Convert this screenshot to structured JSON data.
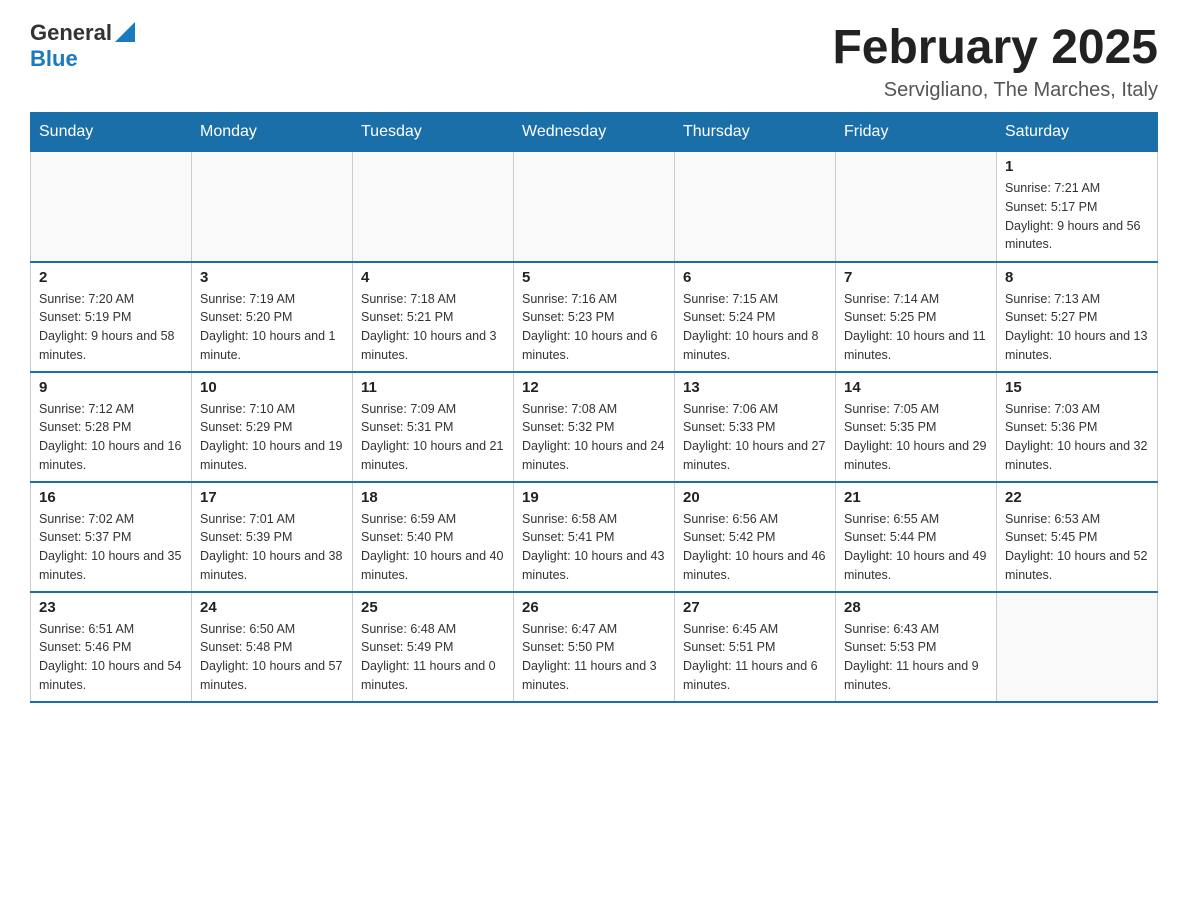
{
  "header": {
    "logo": {
      "text_general": "General",
      "text_blue": "Blue"
    },
    "title": "February 2025",
    "subtitle": "Servigliano, The Marches, Italy"
  },
  "days_of_week": [
    "Sunday",
    "Monday",
    "Tuesday",
    "Wednesday",
    "Thursday",
    "Friday",
    "Saturday"
  ],
  "weeks": [
    {
      "days": [
        {
          "number": "",
          "info": ""
        },
        {
          "number": "",
          "info": ""
        },
        {
          "number": "",
          "info": ""
        },
        {
          "number": "",
          "info": ""
        },
        {
          "number": "",
          "info": ""
        },
        {
          "number": "",
          "info": ""
        },
        {
          "number": "1",
          "info": "Sunrise: 7:21 AM\nSunset: 5:17 PM\nDaylight: 9 hours and 56 minutes."
        }
      ]
    },
    {
      "days": [
        {
          "number": "2",
          "info": "Sunrise: 7:20 AM\nSunset: 5:19 PM\nDaylight: 9 hours and 58 minutes."
        },
        {
          "number": "3",
          "info": "Sunrise: 7:19 AM\nSunset: 5:20 PM\nDaylight: 10 hours and 1 minute."
        },
        {
          "number": "4",
          "info": "Sunrise: 7:18 AM\nSunset: 5:21 PM\nDaylight: 10 hours and 3 minutes."
        },
        {
          "number": "5",
          "info": "Sunrise: 7:16 AM\nSunset: 5:23 PM\nDaylight: 10 hours and 6 minutes."
        },
        {
          "number": "6",
          "info": "Sunrise: 7:15 AM\nSunset: 5:24 PM\nDaylight: 10 hours and 8 minutes."
        },
        {
          "number": "7",
          "info": "Sunrise: 7:14 AM\nSunset: 5:25 PM\nDaylight: 10 hours and 11 minutes."
        },
        {
          "number": "8",
          "info": "Sunrise: 7:13 AM\nSunset: 5:27 PM\nDaylight: 10 hours and 13 minutes."
        }
      ]
    },
    {
      "days": [
        {
          "number": "9",
          "info": "Sunrise: 7:12 AM\nSunset: 5:28 PM\nDaylight: 10 hours and 16 minutes."
        },
        {
          "number": "10",
          "info": "Sunrise: 7:10 AM\nSunset: 5:29 PM\nDaylight: 10 hours and 19 minutes."
        },
        {
          "number": "11",
          "info": "Sunrise: 7:09 AM\nSunset: 5:31 PM\nDaylight: 10 hours and 21 minutes."
        },
        {
          "number": "12",
          "info": "Sunrise: 7:08 AM\nSunset: 5:32 PM\nDaylight: 10 hours and 24 minutes."
        },
        {
          "number": "13",
          "info": "Sunrise: 7:06 AM\nSunset: 5:33 PM\nDaylight: 10 hours and 27 minutes."
        },
        {
          "number": "14",
          "info": "Sunrise: 7:05 AM\nSunset: 5:35 PM\nDaylight: 10 hours and 29 minutes."
        },
        {
          "number": "15",
          "info": "Sunrise: 7:03 AM\nSunset: 5:36 PM\nDaylight: 10 hours and 32 minutes."
        }
      ]
    },
    {
      "days": [
        {
          "number": "16",
          "info": "Sunrise: 7:02 AM\nSunset: 5:37 PM\nDaylight: 10 hours and 35 minutes."
        },
        {
          "number": "17",
          "info": "Sunrise: 7:01 AM\nSunset: 5:39 PM\nDaylight: 10 hours and 38 minutes."
        },
        {
          "number": "18",
          "info": "Sunrise: 6:59 AM\nSunset: 5:40 PM\nDaylight: 10 hours and 40 minutes."
        },
        {
          "number": "19",
          "info": "Sunrise: 6:58 AM\nSunset: 5:41 PM\nDaylight: 10 hours and 43 minutes."
        },
        {
          "number": "20",
          "info": "Sunrise: 6:56 AM\nSunset: 5:42 PM\nDaylight: 10 hours and 46 minutes."
        },
        {
          "number": "21",
          "info": "Sunrise: 6:55 AM\nSunset: 5:44 PM\nDaylight: 10 hours and 49 minutes."
        },
        {
          "number": "22",
          "info": "Sunrise: 6:53 AM\nSunset: 5:45 PM\nDaylight: 10 hours and 52 minutes."
        }
      ]
    },
    {
      "days": [
        {
          "number": "23",
          "info": "Sunrise: 6:51 AM\nSunset: 5:46 PM\nDaylight: 10 hours and 54 minutes."
        },
        {
          "number": "24",
          "info": "Sunrise: 6:50 AM\nSunset: 5:48 PM\nDaylight: 10 hours and 57 minutes."
        },
        {
          "number": "25",
          "info": "Sunrise: 6:48 AM\nSunset: 5:49 PM\nDaylight: 11 hours and 0 minutes."
        },
        {
          "number": "26",
          "info": "Sunrise: 6:47 AM\nSunset: 5:50 PM\nDaylight: 11 hours and 3 minutes."
        },
        {
          "number": "27",
          "info": "Sunrise: 6:45 AM\nSunset: 5:51 PM\nDaylight: 11 hours and 6 minutes."
        },
        {
          "number": "28",
          "info": "Sunrise: 6:43 AM\nSunset: 5:53 PM\nDaylight: 11 hours and 9 minutes."
        },
        {
          "number": "",
          "info": ""
        }
      ]
    }
  ]
}
